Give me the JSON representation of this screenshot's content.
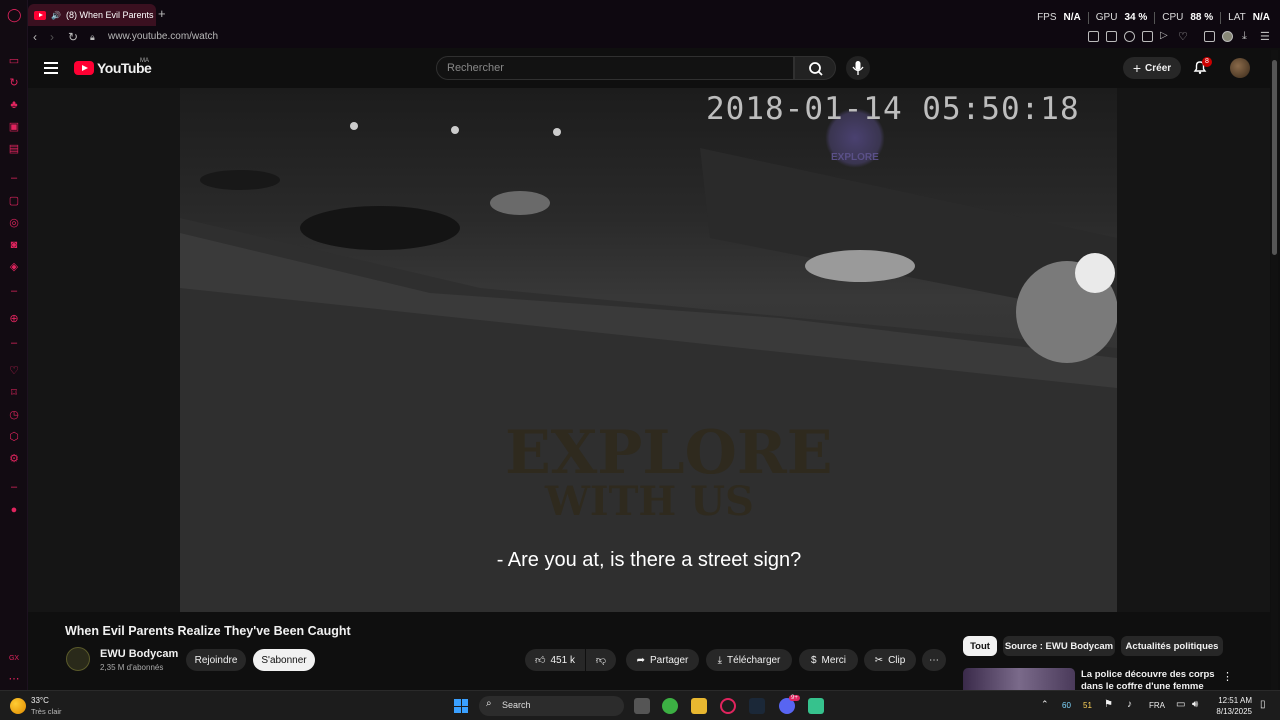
{
  "browser": {
    "tab_title": "(8) When Evil Parents",
    "new_tab": "+",
    "url": "www.youtube.com/watch",
    "perf": {
      "fps_label": "FPS",
      "fps_value": "N/A",
      "gpu_label": "GPU",
      "gpu_value": "34 %",
      "cpu_label": "CPU",
      "cpu_value": "88 %",
      "lat_label": "LAT",
      "lat_value": "N/A"
    }
  },
  "youtube": {
    "logo_text": "YouTube",
    "region": "MA",
    "search_placeholder": "Rechercher",
    "create_label": "Créer",
    "notification_count": "8"
  },
  "video": {
    "timestamp": "2018-01-14 05:50:18",
    "subtitle": "- Are you at, is there a street sign?",
    "watermark_line1": "EXPLORE",
    "watermark_line2": "WITH US",
    "title": "When Evil Parents Realize They've Been Caught",
    "channel_name": "EWU Bodycam",
    "channel_subs": "2,35 M d'abonnés",
    "join_label": "Rejoindre",
    "subscribe_label": "S'abonner",
    "like_count": "451 k",
    "share_label": "Partager",
    "download_label": "Télécharger",
    "thanks_label": "Merci",
    "clip_label": "Clip",
    "more_label": "⋯"
  },
  "sidebar_chips": [
    "Tout",
    "Source : EWU Bodycam",
    "Actualités politiques"
  ],
  "recommended": {
    "title": "La police découvre des corps dans le coffre d'une femme lor..."
  },
  "taskbar": {
    "weather_temp": "33°C",
    "weather_desc": "Très clair",
    "search_label": "Search",
    "tray_a": "60",
    "tray_b": "51",
    "lang": "FRA",
    "time": "12:51 AM",
    "date": "8/13/2025",
    "discord_badge": "9+"
  },
  "colors": {
    "opera_accent": "#e0245e",
    "yt_red": "#ff0033",
    "background": "#0f0f0f"
  }
}
